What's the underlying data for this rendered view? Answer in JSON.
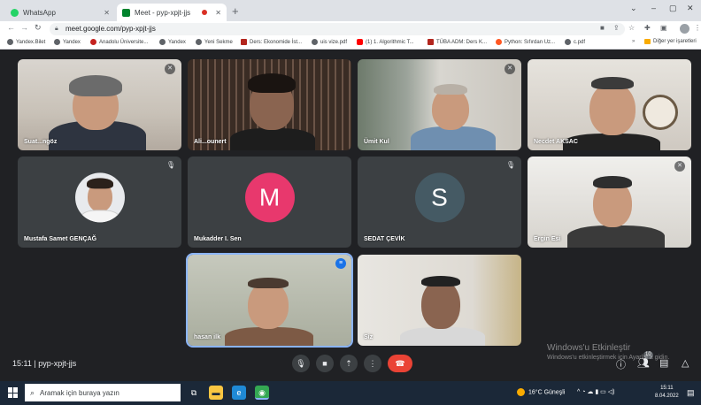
{
  "browser": {
    "tabs": [
      {
        "title": "WhatsApp",
        "close": "✕"
      },
      {
        "title": "Meet - pyp-xpjt-jjs",
        "close": "✕"
      }
    ],
    "new_tab": "+",
    "window_controls": [
      "⌄",
      "–",
      "▢",
      "✕"
    ],
    "url": "meet.google.com/pyp-xpjt-jjs",
    "bookmarks": [
      "Yandex.Bilet",
      "Yandex",
      "Anadolu Üniversite...",
      "Yandex",
      "Yeni Sekme",
      "Ders: Ekonomide İst...",
      "uis vize.pdf",
      "(1) 1. Algorithmic T...",
      "TÜBA ADM: Ders K...",
      "Python: Sıfırdan Uz...",
      "c.pdf"
    ],
    "bookmarks_more": "»",
    "bookmarks_other": "Diğer yer işaretleri"
  },
  "meet": {
    "participants": [
      {
        "name": "Suat...ngöz"
      },
      {
        "name": "Ali...ounert"
      },
      {
        "name": "Ümit Kul"
      },
      {
        "name": "Necdet AKSAC"
      },
      {
        "name": "Mustafa Samet GENÇAĞ"
      },
      {
        "name": "Mukadder I. Sen",
        "initial": "M"
      },
      {
        "name": "SEDAT ÇEVİK",
        "initial": "S"
      },
      {
        "name": "Ergin Esi"
      },
      {
        "name": "hasan ilk"
      },
      {
        "name": "Siz"
      }
    ],
    "time": "15:11",
    "separator": "|",
    "meeting_code": "pyp-xpjt-jjs",
    "people_count": "10"
  },
  "watermark": {
    "line1": "Windows'u Etkinleştir",
    "line2": "Windows'u etkinleştirmek için Ayarlar'a gidin."
  },
  "taskbar": {
    "search_placeholder": "Aramak için buraya yazın",
    "weather": "16°C Güneşli",
    "time": "15:11",
    "date": "8.04.2022"
  },
  "colors": {
    "meet_bg": "#202124",
    "tile_bg": "#3c4043",
    "hangup": "#ea4335",
    "avatar_m": "#e8386d",
    "avatar_s": "#455a64",
    "speaking": "#8ab4f8"
  }
}
